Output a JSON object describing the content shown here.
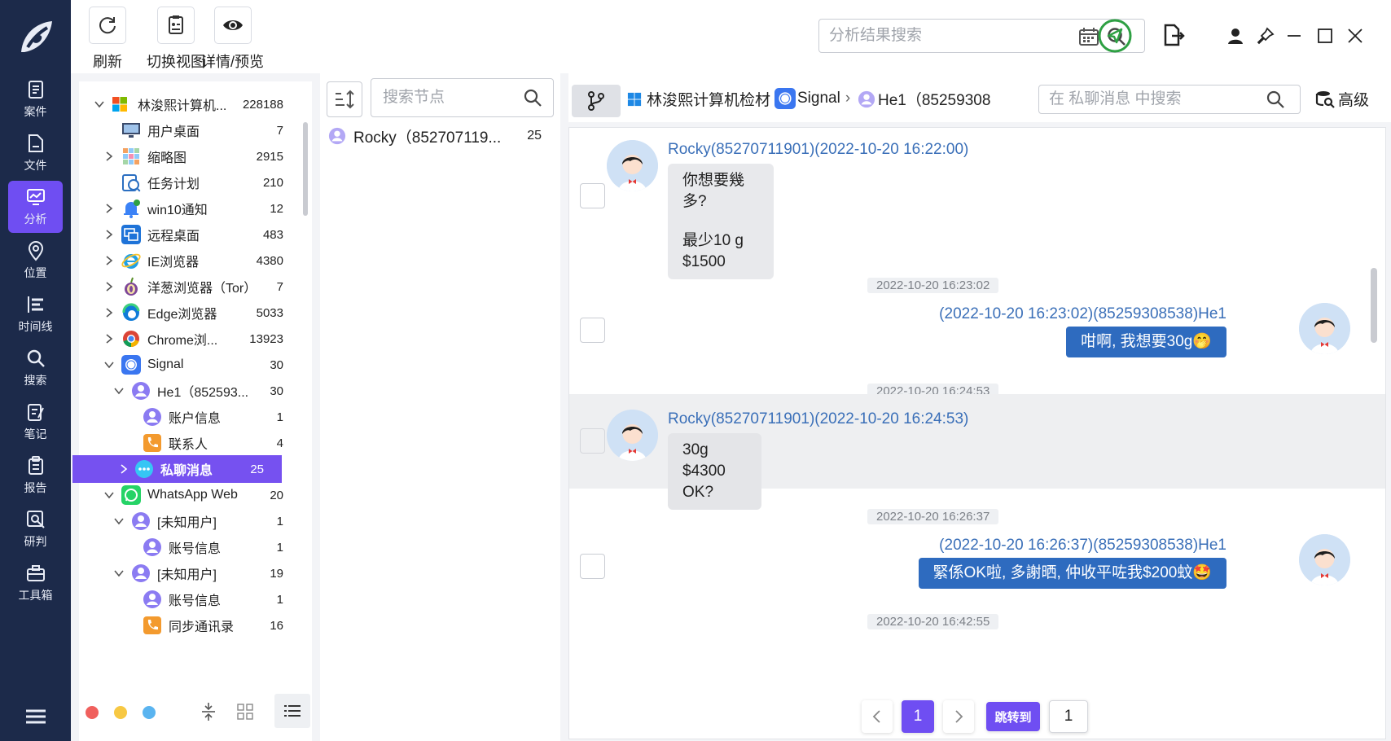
{
  "nav": {
    "items": [
      {
        "label": "案件",
        "icon": "case-icon"
      },
      {
        "label": "文件",
        "icon": "file-icon"
      },
      {
        "label": "分析",
        "icon": "analysis-icon"
      },
      {
        "label": "位置",
        "icon": "location-icon"
      },
      {
        "label": "时间线",
        "icon": "timeline-icon"
      },
      {
        "label": "搜索",
        "icon": "search-icon"
      },
      {
        "label": "笔记",
        "icon": "notes-icon"
      },
      {
        "label": "报告",
        "icon": "report-icon"
      },
      {
        "label": "研判",
        "icon": "research-icon"
      },
      {
        "label": "工具箱",
        "icon": "toolbox-icon"
      }
    ],
    "active": "分析"
  },
  "toolbar": {
    "refresh": "刷新",
    "switch_view": "切换视图",
    "details": "详情/预览",
    "search_placeholder": "分析结果搜索"
  },
  "tree": {
    "rows": [
      {
        "label": "林浚熙计算机...",
        "count": "228188"
      },
      {
        "label": "用户桌面",
        "count": "7"
      },
      {
        "label": "缩略图",
        "count": "2915"
      },
      {
        "label": "任务计划",
        "count": "210"
      },
      {
        "label": "win10通知",
        "count": "12"
      },
      {
        "label": "远程桌面",
        "count": "483"
      },
      {
        "label": "IE浏览器",
        "count": "4380"
      },
      {
        "label": "洋葱浏览器（Tor）",
        "count": "7"
      },
      {
        "label": "Edge浏览器",
        "count": "5033"
      },
      {
        "label": "Chrome浏...",
        "count": "13923"
      },
      {
        "label": "Signal",
        "count": "30"
      },
      {
        "label": "He1（852593...",
        "count": "30"
      },
      {
        "label": "账户信息",
        "count": "1"
      },
      {
        "label": "联系人",
        "count": "4"
      },
      {
        "label": "私聊消息",
        "count": "25"
      },
      {
        "label": "WhatsApp Web",
        "count": "20"
      },
      {
        "label": "[未知用户]",
        "count": "1"
      },
      {
        "label": "账号信息",
        "count": "1"
      },
      {
        "label": "[未知用户]",
        "count": "19"
      },
      {
        "label": "账号信息",
        "count": "1"
      },
      {
        "label": "同步通讯录",
        "count": "16"
      }
    ]
  },
  "node_panel": {
    "search_placeholder": "搜索节点",
    "item_label": "Rocky（852707119...",
    "item_count": "25"
  },
  "breadcrumb": {
    "root": "林浚熙计算机检材",
    "app": "Signal",
    "account": "He1（85259308",
    "search_placeholder": "在 私聊消息 中搜索",
    "advanced": "高级"
  },
  "messages": {
    "m1_sender": "Rocky(85270711901)(2022-10-20 16:22:00)",
    "m1_line1": "你想要幾多?",
    "m1_line2": "最少10 g",
    "m1_line3": "$1500",
    "ts1": "2022-10-20 16:23:02",
    "m2_sender": "(2022-10-20 16:23:02)(85259308538)He1",
    "m2_text": "咁啊, 我想要30g🤭",
    "ts2": "2022-10-20 16:24:53",
    "m3_sender": "Rocky(85270711901)(2022-10-20 16:24:53)",
    "m3_line1": "30g $4300",
    "m3_line2": "OK?",
    "ts3": "2022-10-20 16:26:37",
    "m4_sender": "(2022-10-20 16:26:37)(85259308538)He1",
    "m4_text": "緊係OK啦, 多謝晒, 仲收平咗我$200蚊🤩",
    "ts4": "2022-10-20 16:42:55"
  },
  "pager": {
    "current": "1",
    "jump_label": "跳转到",
    "jump_value": "1"
  },
  "colors": {
    "nav_bg": "#1c2a4a",
    "accent": "#7651f0",
    "outgoing_bubble": "#2e6bbf",
    "sender_text": "#3a6fb8"
  }
}
